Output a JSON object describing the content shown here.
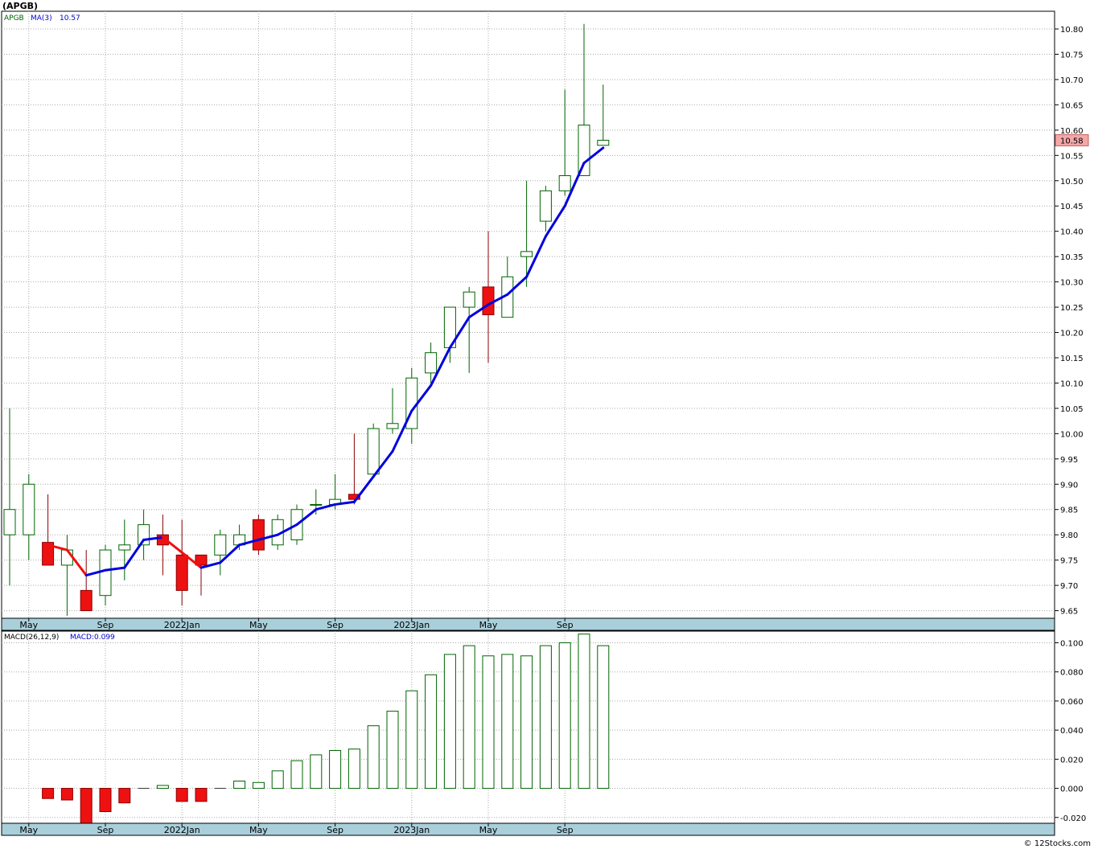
{
  "chart_data": {
    "type": "candlestick",
    "title": "(APGB)",
    "footer": "© 12Stocks.com",
    "price_panel": {
      "legend": [
        {
          "label": "APGB",
          "color": "#006400"
        },
        {
          "label": "MA(3)",
          "color": "#0000cc"
        },
        {
          "label": "10.57",
          "color": "#0000cc"
        }
      ],
      "ylim": [
        9.635,
        10.835
      ],
      "yticks": [
        "9.65",
        "9.70",
        "9.75",
        "9.80",
        "9.85",
        "9.90",
        "9.95",
        "10.00",
        "10.05",
        "10.10",
        "10.15",
        "10.20",
        "10.25",
        "10.30",
        "10.35",
        "10.40",
        "10.45",
        "10.50",
        "10.55",
        "10.60",
        "10.65",
        "10.70",
        "10.75",
        "10.80"
      ],
      "last_price": "10.58",
      "last_price_value": 10.58,
      "candles": [
        {
          "o": 9.8,
          "h": 10.05,
          "l": 9.7,
          "c": 9.85
        },
        {
          "o": 9.8,
          "h": 9.92,
          "l": 9.75,
          "c": 9.9
        },
        {
          "o": 9.785,
          "h": 9.88,
          "l": 9.74,
          "c": 9.74
        },
        {
          "o": 9.74,
          "h": 9.8,
          "l": 9.64,
          "c": 9.77
        },
        {
          "o": 9.69,
          "h": 9.77,
          "l": 9.65,
          "c": 9.65
        },
        {
          "o": 9.68,
          "h": 9.78,
          "l": 9.66,
          "c": 9.77
        },
        {
          "o": 9.77,
          "h": 9.83,
          "l": 9.71,
          "c": 9.78
        },
        {
          "o": 9.78,
          "h": 9.85,
          "l": 9.75,
          "c": 9.82
        },
        {
          "o": 9.8,
          "h": 9.84,
          "l": 9.72,
          "c": 9.78
        },
        {
          "o": 9.76,
          "h": 9.83,
          "l": 9.66,
          "c": 9.69
        },
        {
          "o": 9.76,
          "h": 9.76,
          "l": 9.68,
          "c": 9.74
        },
        {
          "o": 9.76,
          "h": 9.81,
          "l": 9.72,
          "c": 9.8
        },
        {
          "o": 9.78,
          "h": 9.82,
          "l": 9.77,
          "c": 9.8
        },
        {
          "o": 9.83,
          "h": 9.84,
          "l": 9.76,
          "c": 9.77
        },
        {
          "o": 9.78,
          "h": 9.84,
          "l": 9.77,
          "c": 9.83
        },
        {
          "o": 9.79,
          "h": 9.86,
          "l": 9.78,
          "c": 9.85
        },
        {
          "o": 9.86,
          "h": 9.89,
          "l": 9.84,
          "c": 9.86
        },
        {
          "o": 9.86,
          "h": 9.92,
          "l": 9.85,
          "c": 9.87
        },
        {
          "o": 9.88,
          "h": 10.0,
          "l": 9.86,
          "c": 9.87
        },
        {
          "o": 9.92,
          "h": 10.02,
          "l": 9.92,
          "c": 10.01
        },
        {
          "o": 10.01,
          "h": 10.09,
          "l": 10.0,
          "c": 10.02
        },
        {
          "o": 10.01,
          "h": 10.13,
          "l": 9.98,
          "c": 10.11
        },
        {
          "o": 10.12,
          "h": 10.18,
          "l": 10.1,
          "c": 10.16
        },
        {
          "o": 10.17,
          "h": 10.25,
          "l": 10.14,
          "c": 10.25
        },
        {
          "o": 10.25,
          "h": 10.29,
          "l": 10.12,
          "c": 10.28
        },
        {
          "o": 10.29,
          "h": 10.4,
          "l": 10.14,
          "c": 10.235
        },
        {
          "o": 10.23,
          "h": 10.35,
          "l": 10.23,
          "c": 10.31
        },
        {
          "o": 10.35,
          "h": 10.5,
          "l": 10.29,
          "c": 10.36
        },
        {
          "o": 10.42,
          "h": 10.49,
          "l": 10.4,
          "c": 10.48
        },
        {
          "o": 10.48,
          "h": 10.68,
          "l": 10.47,
          "c": 10.51
        },
        {
          "o": 10.51,
          "h": 10.81,
          "l": 10.51,
          "c": 10.61
        },
        {
          "o": 10.57,
          "h": 10.69,
          "l": 10.57,
          "c": 10.58
        }
      ],
      "ma3": [
        null,
        null,
        9.78,
        9.77,
        9.72,
        9.73,
        9.735,
        9.79,
        9.795,
        9.765,
        9.735,
        9.745,
        9.78,
        9.79,
        9.8,
        9.82,
        9.85,
        9.86,
        9.865,
        9.915,
        9.965,
        10.045,
        10.095,
        10.17,
        10.23,
        10.255,
        10.275,
        10.31,
        10.39,
        10.45,
        10.535,
        10.565
      ]
    },
    "macd_panel": {
      "legend": [
        {
          "label": "MACD(26,12,9)",
          "color": "#000000"
        },
        {
          "label": "MACD:0.099",
          "color": "#0000cc"
        }
      ],
      "ylim": [
        -0.024,
        0.108
      ],
      "yticks": [
        "-0.020",
        "0.000",
        "0.020",
        "0.040",
        "0.060",
        "0.080",
        "0.100"
      ],
      "values": [
        null,
        null,
        -0.007,
        -0.008,
        -0.024,
        -0.016,
        -0.01,
        0.0,
        0.002,
        -0.009,
        -0.009,
        0.0,
        0.005,
        0.004,
        0.012,
        0.019,
        0.023,
        0.026,
        0.027,
        0.043,
        0.053,
        0.067,
        0.078,
        0.092,
        0.098,
        0.091,
        0.092,
        0.091,
        0.098,
        0.1,
        0.106,
        0.098
      ]
    },
    "x_labels": [
      {
        "i": 1,
        "label": "May"
      },
      {
        "i": 5,
        "label": "Sep"
      },
      {
        "i": 9,
        "label": "2022Jan"
      },
      {
        "i": 13,
        "label": "May"
      },
      {
        "i": 17,
        "label": "Sep"
      },
      {
        "i": 21,
        "label": "2023Jan"
      },
      {
        "i": 25,
        "label": "May"
      },
      {
        "i": 29,
        "label": "Sep"
      }
    ],
    "colors": {
      "up_body": "#ffffff",
      "up_outline": "#006400",
      "down_body": "#ee1111",
      "down_outline": "#8b0000",
      "ma_up": "#0000dd",
      "ma_down": "#ee1111",
      "grid": "#a8a8a8",
      "axis_band": "#a9cfdb",
      "last_price_bg": "#f4a7a7"
    },
    "grid": true
  }
}
